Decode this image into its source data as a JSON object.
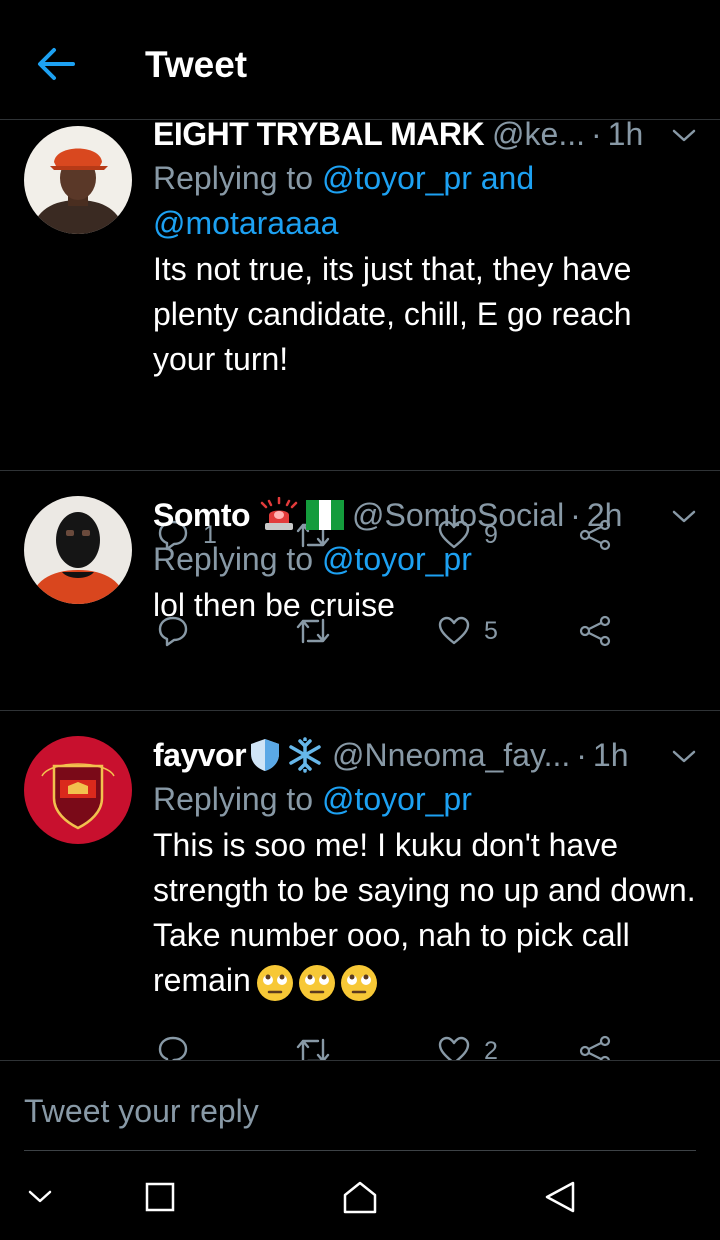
{
  "header": {
    "title": "Tweet",
    "back_icon": "arrow-left-icon"
  },
  "colors": {
    "accent": "#1da1f2",
    "muted": "#8899a6",
    "divider": "#2f3336",
    "background": "#000000"
  },
  "tweets": [
    {
      "name": "EIGHT TRYBAL MARK",
      "handle": "@ke...",
      "time": "1h",
      "reply_prefix": "Replying to",
      "reply_to_1": "@toyor_pr",
      "reply_and": "and",
      "reply_to_2": "@motaraaaa",
      "body": "Its not true, its just that, they have plenty candidate, chill, E go reach your turn!",
      "replies": "1",
      "retweets": "",
      "likes": "9"
    },
    {
      "name": "Somto",
      "name_emojis": [
        "police-light-emoji",
        "nigeria-flag-emoji"
      ],
      "handle": "@SomtoSocial",
      "time": "2h",
      "reply_prefix": "Replying to",
      "reply_to_1": "@toyor_pr",
      "body": "lol then be cruise",
      "replies": "",
      "retweets": "",
      "likes": "5"
    },
    {
      "name": "fayvor",
      "name_emojis": [
        "shield-emoji",
        "snowflake-emoji"
      ],
      "handle": "@Nneoma_fay...",
      "time": "1h",
      "reply_prefix": "Replying to",
      "reply_to_1": "@toyor_pr",
      "body": "This is soo me! I kuku don't have strength to be saying no up and down. Take number ooo, nah to pick call remain",
      "body_emojis": [
        "eye-roll-emoji",
        "eye-roll-emoji",
        "eye-roll-emoji"
      ],
      "replies": "",
      "retweets": "",
      "likes": "2"
    }
  ],
  "compose": {
    "placeholder": "Tweet your reply"
  },
  "navbar": {
    "icons": [
      "chevron-down-icon",
      "recents-square-icon",
      "home-icon",
      "back-triangle-icon"
    ]
  }
}
